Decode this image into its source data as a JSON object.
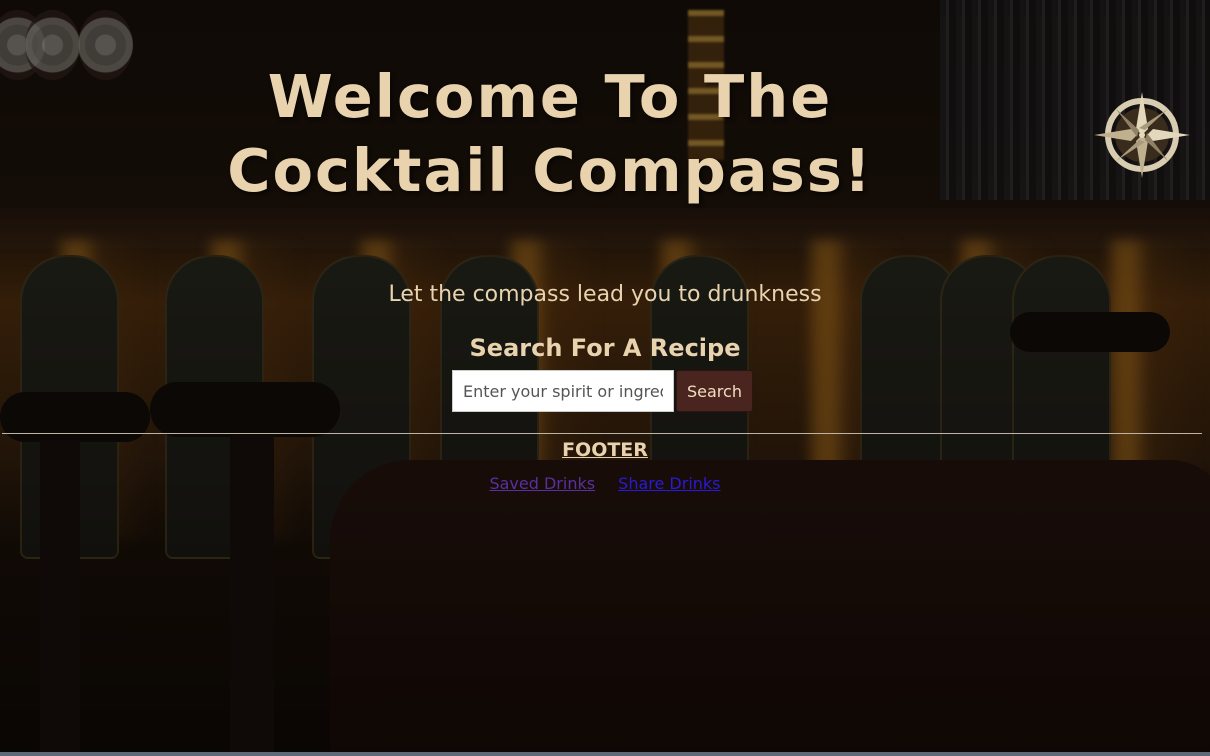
{
  "header": {
    "title": "Welcome To The Cocktail Compass!",
    "logo_icon": "compass-rose-icon"
  },
  "main": {
    "tagline": "Let the compass lead you to drunkness",
    "search": {
      "heading": "Search For A Recipe",
      "placeholder": "Enter your spirit or ingredient",
      "value": "",
      "button_label": "Search"
    }
  },
  "footer": {
    "heading": "FOOTER",
    "links": [
      {
        "label": "Saved Drinks",
        "color": "#5a2fa0"
      },
      {
        "label": "Share Drinks",
        "color": "#2a1ad8"
      }
    ]
  },
  "colors": {
    "text_accent": "#e9d3ae",
    "button_bg": "#4a2520"
  }
}
